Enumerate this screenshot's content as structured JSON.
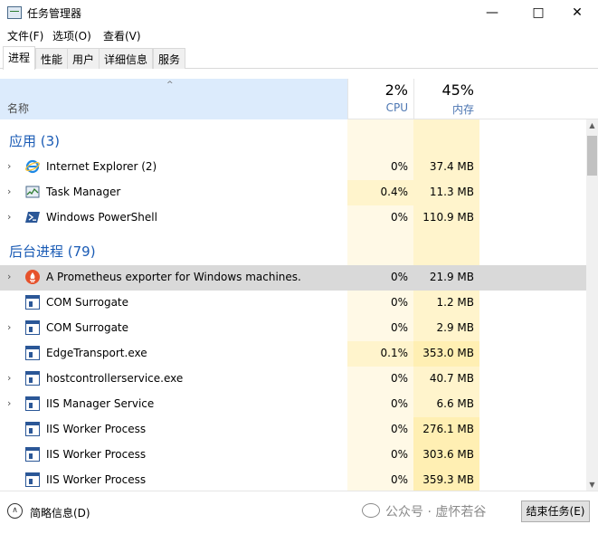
{
  "window": {
    "title": "任务管理器",
    "minimize_glyph": "—",
    "maximize_glyph": "□",
    "close_glyph": "✕"
  },
  "menu": [
    "文件(F)",
    "选项(O)",
    "查看(V)"
  ],
  "tabs": [
    "进程",
    "性能",
    "用户",
    "详细信息",
    "服务"
  ],
  "active_tab": "进程",
  "columns": {
    "name_label": "名称",
    "sort_glyph": "^",
    "cpu_total": "2%",
    "cpu_label": "CPU",
    "mem_total": "45%",
    "mem_label": "内存"
  },
  "groups": {
    "apps": "应用 (3)",
    "background": "后台进程 (79)"
  },
  "processes": [
    {
      "name": "Internet Explorer (2)",
      "cpu": "0%",
      "mem": "37.4 MB",
      "icon": "internet-explorer-icon",
      "expandable": true
    },
    {
      "name": "Task Manager",
      "cpu": "0.4%",
      "mem": "11.3 MB",
      "icon": "task-manager-icon",
      "expandable": true
    },
    {
      "name": "Windows PowerShell",
      "cpu": "0%",
      "mem": "110.9 MB",
      "icon": "powershell-icon",
      "expandable": true
    },
    {
      "name": "A Prometheus exporter for Windows machines.",
      "cpu": "0%",
      "mem": "21.9 MB",
      "icon": "prometheus-icon",
      "expandable": true,
      "selected": true
    },
    {
      "name": "COM Surrogate",
      "cpu": "0%",
      "mem": "1.2 MB",
      "icon": "exe-icon",
      "expandable": false
    },
    {
      "name": "COM Surrogate",
      "cpu": "0%",
      "mem": "2.9 MB",
      "icon": "exe-icon",
      "expandable": true
    },
    {
      "name": "EdgeTransport.exe",
      "cpu": "0.1%",
      "mem": "353.0 MB",
      "icon": "exe-icon",
      "expandable": false
    },
    {
      "name": "hostcontrollerservice.exe",
      "cpu": "0%",
      "mem": "40.7 MB",
      "icon": "exe-icon",
      "expandable": true
    },
    {
      "name": "IIS Manager Service",
      "cpu": "0%",
      "mem": "6.6 MB",
      "icon": "exe-icon",
      "expandable": true
    },
    {
      "name": "IIS Worker Process",
      "cpu": "0%",
      "mem": "276.1 MB",
      "icon": "exe-icon",
      "expandable": false
    },
    {
      "name": "IIS Worker Process",
      "cpu": "0%",
      "mem": "303.6 MB",
      "icon": "exe-icon",
      "expandable": false
    },
    {
      "name": "IIS Worker Process",
      "cpu": "0%",
      "mem": "359.3 MB",
      "icon": "exe-icon",
      "expandable": false
    }
  ],
  "footer": {
    "fewer_details": "简略信息(D)",
    "watermark": "公众号 · 虚怀若谷",
    "end_task": "结束任务(E)"
  },
  "colors": {
    "accent": "#1a5bb5",
    "header_highlight": "#dcebfc",
    "selected_row": "#d9d9d9",
    "cpu_band": "#fff9e6",
    "mem_band": "#fff4cc"
  }
}
